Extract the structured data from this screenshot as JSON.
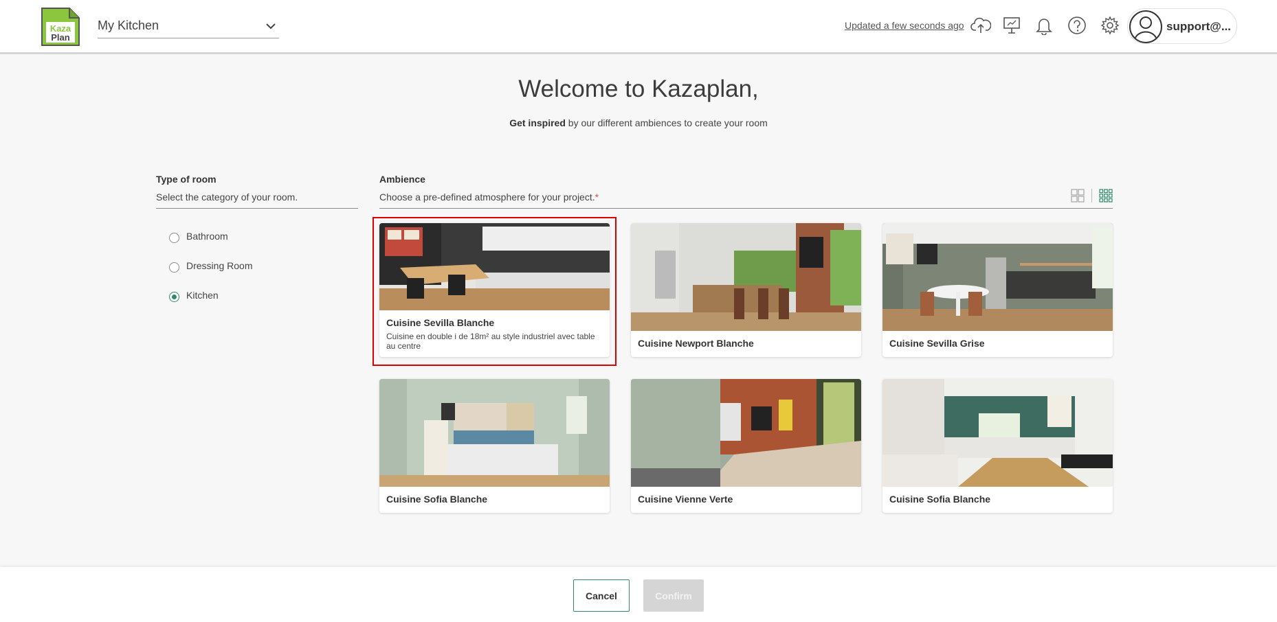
{
  "header": {
    "logo_line1": "Kaza",
    "logo_line2": "Plan",
    "project_name": "My Kitchen",
    "updated_text": "Updated a few seconds ago",
    "user_name": "support@..."
  },
  "icons": {
    "cloud": "cloud-upload-icon",
    "monitor": "presentation-icon",
    "bell": "bell-icon",
    "help": "help-icon",
    "settings": "gear-icon",
    "avatar": "user-avatar-icon"
  },
  "welcome": {
    "title": "Welcome to Kazaplan,",
    "subtitle_bold": "Get inspired",
    "subtitle_rest": " by our different ambiences to create your room"
  },
  "room_type": {
    "title": "Type of room",
    "description": "Select the category of your room.",
    "options": [
      {
        "label": "Bathroom",
        "checked": false
      },
      {
        "label": "Dressing Room",
        "checked": false
      },
      {
        "label": "Kitchen",
        "checked": true
      }
    ]
  },
  "ambience": {
    "title": "Ambience",
    "description": "Choose a pre-defined atmosphere for your project.",
    "required_mark": "*",
    "cards": [
      {
        "name": "Cuisine Sevilla Blanche",
        "description": "Cuisine en double i de 18m² au style industriel avec table au centre",
        "selected": true
      },
      {
        "name": "Cuisine Newport Blanche",
        "description": "",
        "selected": false
      },
      {
        "name": "Cuisine Sevilla Grise",
        "description": "",
        "selected": false
      },
      {
        "name": "Cuisine Sofia Blanche",
        "description": "",
        "selected": false
      },
      {
        "name": "Cuisine Vienne Verte",
        "description": "",
        "selected": false
      },
      {
        "name": "Cuisine Sofia Blanche",
        "description": "",
        "selected": false
      }
    ]
  },
  "footer": {
    "cancel_label": "Cancel",
    "confirm_label": "Confirm"
  },
  "colors": {
    "accent": "#2e8a6b",
    "selection": "#e00000",
    "logo_green": "#8cc63f"
  }
}
